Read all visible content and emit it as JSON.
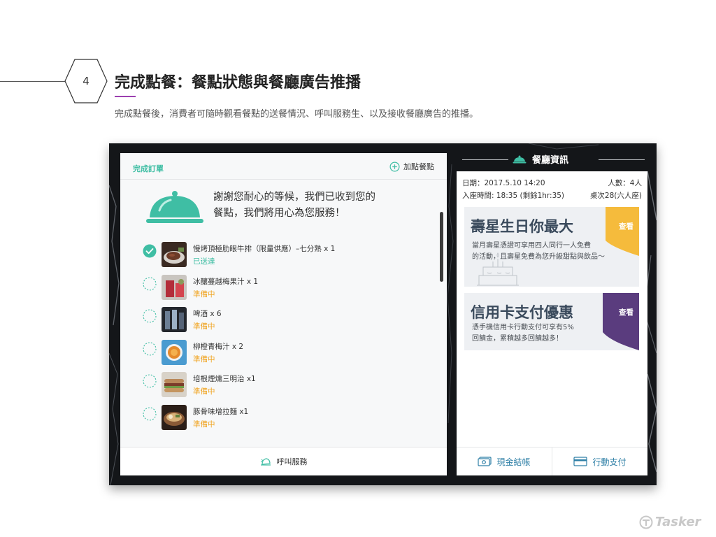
{
  "header": {
    "step_number": "4",
    "title": "完成點餐：餐點狀態與餐廳廣告推播",
    "subtitle": "完成點餐後，消費者可隨時觀看餐點的送餐情況、呼叫服務生、以及接收餐廳廣告的推播。"
  },
  "order_panel": {
    "title": "完成訂單",
    "add_label": "加點餐點",
    "thanks_line1": "謝謝您耐心的等候，我們已收到您的",
    "thanks_line2": "餐點，我們將用心為您服務！",
    "items": [
      {
        "name": "慢烤頂極肋眼牛排（限量供應）–七分熟 x 1",
        "status": "已送達",
        "done": true
      },
      {
        "name": "冰釀蔓越梅果汁 x 1",
        "status": "準備中",
        "done": false
      },
      {
        "name": "啤酒 x 6",
        "status": "準備中",
        "done": false
      },
      {
        "name": "柳橙青梅汁 x 2",
        "status": "準備中",
        "done": false
      },
      {
        "name": "培根煙燻三明治 x1",
        "status": "準備中",
        "done": false
      },
      {
        "name": "豚骨味增拉麵 x1",
        "status": "準備中",
        "done": false
      }
    ],
    "call_service_label": "呼叫服務"
  },
  "restaurant_panel": {
    "title": "餐廳資訊",
    "date": "日期：2017.5.10 14:20",
    "people": "人數：4人",
    "seated": "入座時間: 18:35 (剩餘1hr:35)",
    "table": "桌次28(六人座)",
    "ads": [
      {
        "heading": "壽星生日你最大",
        "line1": "當月壽星憑證可享用四人同行一人免費",
        "line2": "的活動，且壽星免費為您升級甜點與飲品～",
        "cta": "查看",
        "color": "#f5bb3c"
      },
      {
        "heading": "信用卡支付優惠",
        "line1": "憑手機信用卡行動支付可享有5%",
        "line2": "回饋金，累積越多回饋越多！",
        "cta": "查看",
        "color": "#5a3c7e"
      }
    ],
    "cash_label": "現金結帳",
    "mobile_label": "行動支付"
  },
  "brand": {
    "name": "Tasker"
  },
  "colors": {
    "accent": "#3fbea4",
    "preparing": "#f0a31f",
    "pay": "#2e7fa6",
    "underline": "#9b3fb0"
  }
}
